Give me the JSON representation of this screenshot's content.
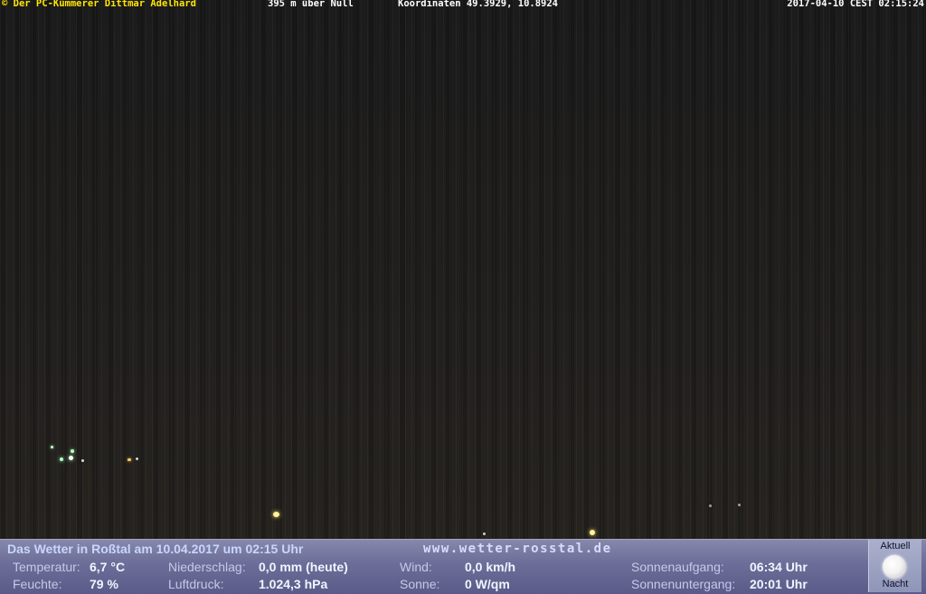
{
  "overlay": {
    "copyright": "© Der PC-Kümmerer Dittmar Adelhard",
    "altitude": "395 m über Null",
    "coordinates": "Koordinaten 49.3929, 10.8924",
    "timestamp": "2017-04-10 CEST 02:15:24"
  },
  "info": {
    "headline": "Das Wetter in Roßtal am 10.04.2017 um 02:15 Uhr",
    "website": "www.wetter-rosstal.de",
    "temperature": {
      "label": "Temperatur:",
      "value": "6,7 °C"
    },
    "humidity": {
      "label": "Feuchte:",
      "value": "79 %"
    },
    "precipitation": {
      "label": "Niederschlag:",
      "value": "0,0 mm (heute)"
    },
    "pressure": {
      "label": "Luftdruck:",
      "value": "1.024,3 hPa"
    },
    "wind": {
      "label": "Wind:",
      "value": "0,0 km/h"
    },
    "sun": {
      "label": "Sonne:",
      "value": "0 W/qm"
    },
    "sunrise": {
      "label": "Sonnenaufgang:",
      "value": "06:34 Uhr"
    },
    "sunset": {
      "label": "Sonnenuntergang:",
      "value": "20:01 Uhr"
    }
  },
  "moon": {
    "top_label": "Aktuell",
    "bottom_label": "Nacht",
    "icon": "full-moon-icon"
  },
  "colors": {
    "copyright": "#ffe600",
    "overlay_text": "#ffffff",
    "info_bar": "#6c6d98",
    "headline": "#c8d6ff"
  }
}
